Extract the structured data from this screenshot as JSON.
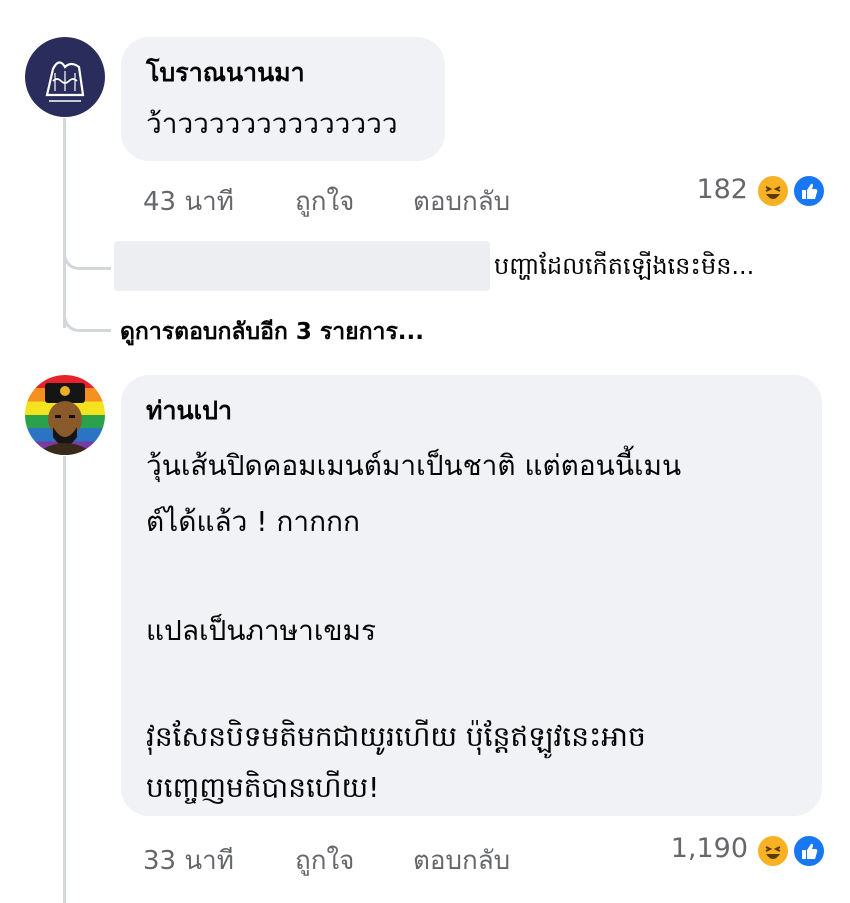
{
  "comments": [
    {
      "author": "โบราณนานมา",
      "text": "ว้าวววววววววววววว",
      "time": "43 นาที",
      "like_label": "ถูกใจ",
      "reply_label": "ตอบกลับ",
      "reaction_count": "182"
    },
    {
      "author": "ท่านเปา",
      "text_lines": [
        "วุ้นเส้นปิดคอมเมนต์มาเป็นชาติ แต่ตอนนี้เมน",
        "ต์ได้แล้ว ! กากกก",
        "",
        "แปลเป็นภาษาเขมร",
        "",
        "វុនសែនបិទមតិមកជាយូរហើយ ប៉ុន្តែឥឡូវនេះអាច",
        "បញ្ចេញមតិបានហើយ!"
      ],
      "time": "33 นาที",
      "like_label": "ถูกใจ",
      "reply_label": "ตอบกลับ",
      "reaction_count": "1,190"
    }
  ],
  "reply_preview": {
    "text": "បញ្ហាដែលកើតឡើងនេះមិន..."
  },
  "view_more_replies": "ดูการตอบกลับอีก 3 รายการ...",
  "reactions": {
    "haha_icon": "haha-emoji-icon",
    "like_icon": "like-thumb-icon",
    "haha_color": "#f7b125",
    "like_color": "#1877f2"
  }
}
